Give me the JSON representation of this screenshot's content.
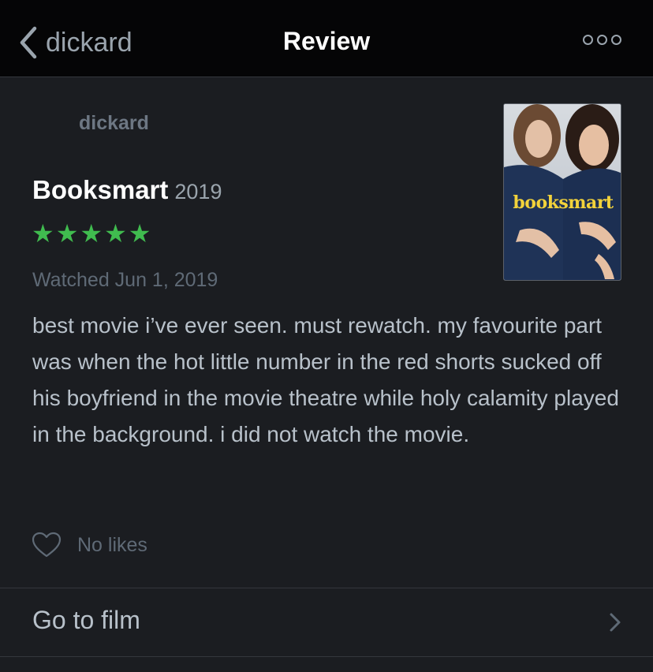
{
  "nav": {
    "back_label": "dickard",
    "title": "Review",
    "more_icon": "more-icon"
  },
  "review": {
    "reviewer": "dickard",
    "film_title": "Booksmart",
    "film_year": "2019",
    "rating": 5,
    "rating_max": 5,
    "stars": [
      "★",
      "★",
      "★",
      "★",
      "★"
    ],
    "watched": "Watched Jun 1, 2019",
    "text": "best movie i’ve ever seen. must rewatch. my favourite part was when the hot little number in the red shorts sucked off his boyfriend in the movie theatre while holy calamity played in the background. i did not watch the movie."
  },
  "poster": {
    "title_text": "booksmart",
    "title_color": "#f2d23b"
  },
  "likes": {
    "label": "No likes",
    "icon": "heart-icon"
  },
  "footer": {
    "goto_label": "Go to film",
    "icon": "chevron-right-icon"
  },
  "colors": {
    "background": "#1b1d21",
    "navbar": "#050506",
    "star": "#40bc4f",
    "muted": "#5f6a76",
    "text": "#b8c1ca"
  }
}
